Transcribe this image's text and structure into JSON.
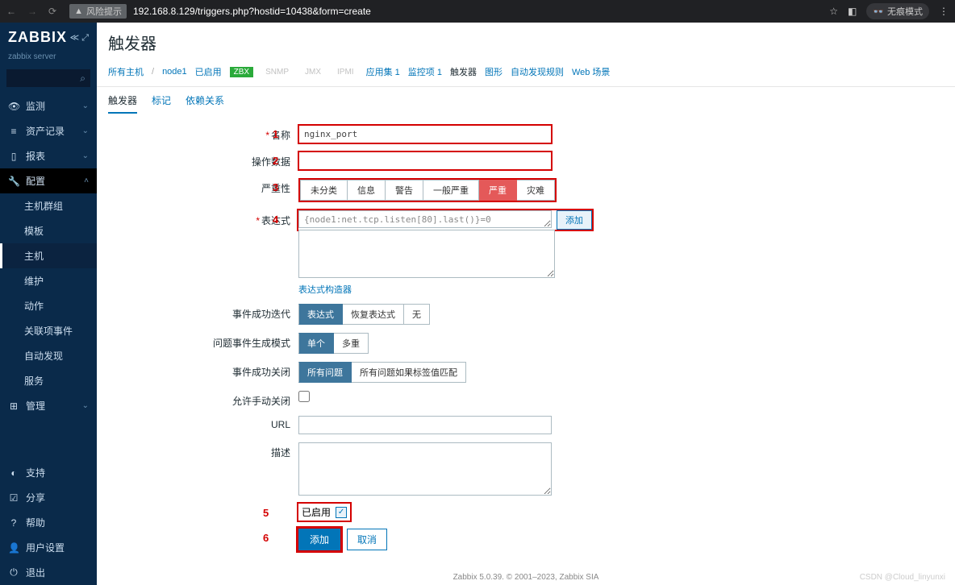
{
  "browser": {
    "warn_label": "风险提示",
    "url": "192.168.8.129/triggers.php?hostid=10438&form=create",
    "incognito": "无痕模式"
  },
  "sidebar": {
    "logo1": "ZABBIX",
    "server": "zabbix server",
    "items": {
      "monitor": "监测",
      "inventory": "资产记录",
      "reports": "报表",
      "config": "配置",
      "admin": "管理"
    },
    "config_sub": {
      "hostgroups": "主机群组",
      "templates": "模板",
      "hosts": "主机",
      "maintenance": "维护",
      "actions": "动作",
      "correlation": "关联项事件",
      "discovery": "自动发现",
      "services": "服务"
    },
    "bottom": {
      "support": "支持",
      "share": "分享",
      "help": "帮助",
      "usersettings": "用户设置",
      "logout": "退出"
    }
  },
  "page": {
    "title": "触发器",
    "crumbs": {
      "allhosts": "所有主机",
      "node": "node1",
      "enabled": "已启用",
      "zbx": "ZBX",
      "snmp": "SNMP",
      "jmx": "JMX",
      "ipmi": "IPMI",
      "apps": "应用集 1",
      "items": "监控项 1",
      "triggers": "触发器",
      "graphs": "图形",
      "discovery": "自动发现规则",
      "web": "Web 场景"
    },
    "tabs": {
      "trigger": "触发器",
      "tags": "标记",
      "deps": "依赖关系"
    }
  },
  "form": {
    "labels": {
      "name": "名称",
      "opdata": "操作数据",
      "severity": "严重性",
      "expression": "表达式",
      "expr_constructor": "表达式构造器",
      "ok_event": "事件成功迭代",
      "problem_mode": "问题事件生成模式",
      "ok_close": "事件成功关闭",
      "manual_close": "允许手动关闭",
      "url": "URL",
      "description": "描述",
      "enabled": "已启用"
    },
    "values": {
      "name": "nginx_port",
      "opdata": "",
      "expression": "{node1:net.tcp.listen[80].last()}=0",
      "url": "",
      "description": ""
    },
    "severity": [
      "未分类",
      "信息",
      "警告",
      "一般严重",
      "严重",
      "灾难"
    ],
    "ok_event": [
      "表达式",
      "恢复表达式",
      "无"
    ],
    "problem_mode": [
      "单个",
      "多重"
    ],
    "ok_close": [
      "所有问题",
      "所有问题如果标签值匹配"
    ],
    "buttons": {
      "add_expr": "添加",
      "add": "添加",
      "cancel": "取消"
    },
    "hints": {
      "n1": "1",
      "n2": "2",
      "n3": "3",
      "n4": "4",
      "n5": "5",
      "n6": "6"
    }
  },
  "footer": "Zabbix 5.0.39. © 2001–2023, Zabbix SIA",
  "watermark": "CSDN @Cloud_linyunxi"
}
